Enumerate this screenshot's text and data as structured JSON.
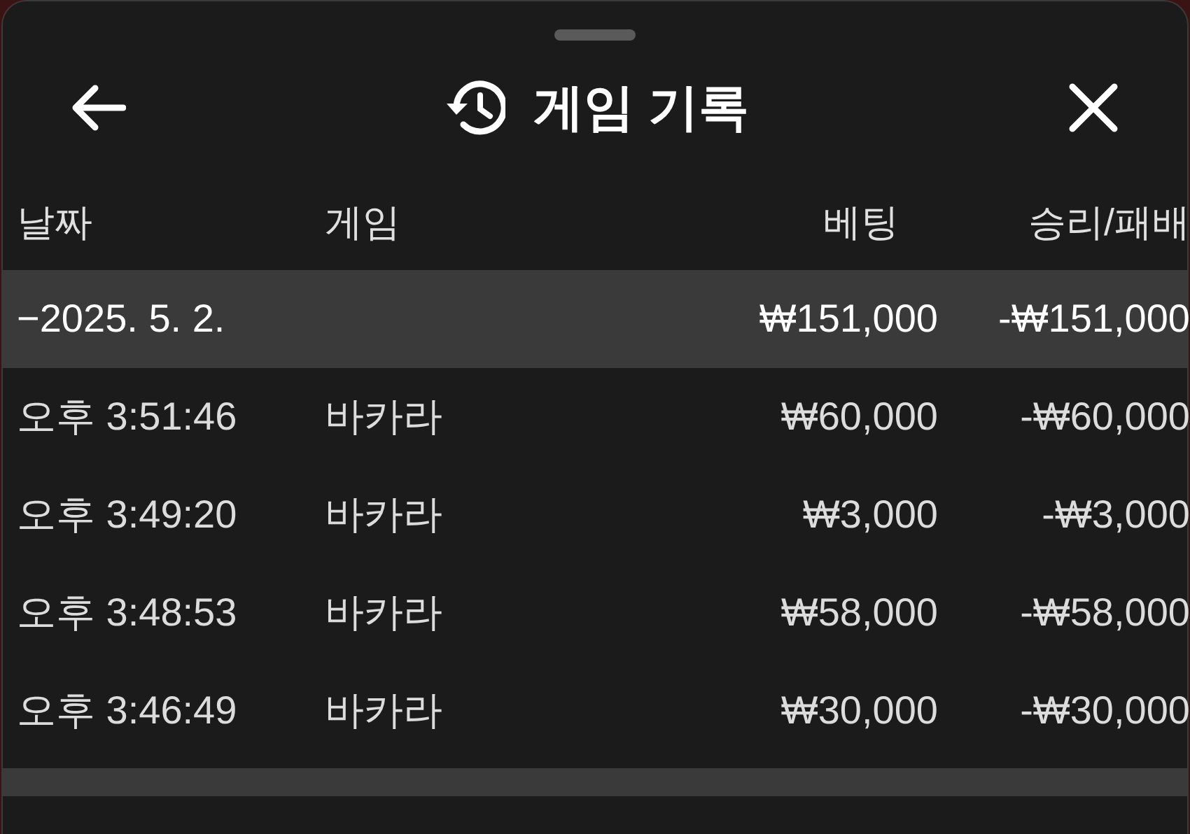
{
  "header": {
    "title": "게임 기록"
  },
  "columns": [
    "날짜",
    "게임",
    "베팅",
    "승리/패배"
  ],
  "groups": [
    {
      "toggle": "−",
      "date": "2025. 5. 2.",
      "bet": "₩151,000",
      "result": "-₩151,000",
      "rows": [
        {
          "time": "오후 3:51:46",
          "game": "바카라",
          "bet": "₩60,000",
          "result": "-₩60,000"
        },
        {
          "time": "오후 3:49:20",
          "game": "바카라",
          "bet": "₩3,000",
          "result": "-₩3,000"
        },
        {
          "time": "오후 3:48:53",
          "game": "바카라",
          "bet": "₩58,000",
          "result": "-₩58,000"
        },
        {
          "time": "오후 3:46:49",
          "game": "바카라",
          "bet": "₩30,000",
          "result": "-₩30,000"
        }
      ]
    }
  ]
}
